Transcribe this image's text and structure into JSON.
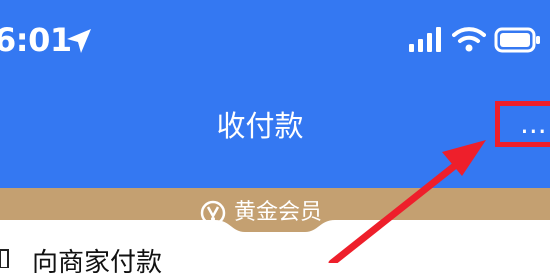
{
  "status_bar": {
    "time": "6:01",
    "location_icon": "location-arrow-icon",
    "signal_icon": "cellular-signal-icon",
    "wifi_icon": "wifi-icon",
    "battery_icon": "battery-icon"
  },
  "nav_bar": {
    "title": "收付款",
    "more_label": "...",
    "more_icon": "more-dots-icon",
    "highlight_color": "#ee1f2b"
  },
  "member_banner": {
    "label": "黄金会员",
    "icon": "gold-medal-icon",
    "color": "#c4a071"
  },
  "annotation": {
    "arrow_color": "#ee1f2b"
  },
  "list": {
    "first_item_label": "向商家付款",
    "first_item_icon": "qr-code-icon"
  },
  "colors": {
    "header_blue": "#3478f2",
    "banner_gold": "#c4a071"
  }
}
